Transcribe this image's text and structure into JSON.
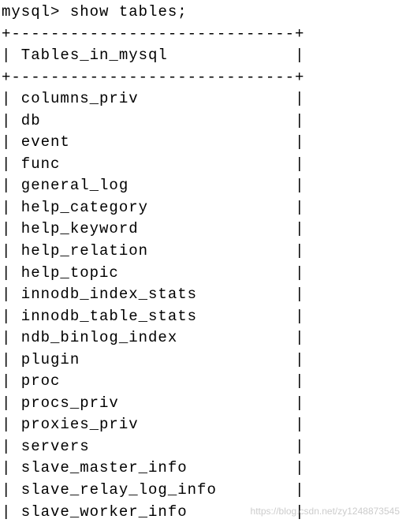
{
  "prompt": "mysql> ",
  "command": "show tables;",
  "border_top": "+-----------------------------+",
  "border_mid": "+-----------------------------+",
  "header": {
    "pipe_left": "|",
    "col_name": " Tables_in_mysql             ",
    "pipe_right": "|"
  },
  "rows": [
    " columns_priv                ",
    " db                          ",
    " event                       ",
    " func                        ",
    " general_log                 ",
    " help_category               ",
    " help_keyword                ",
    " help_relation               ",
    " help_topic                  ",
    " innodb_index_stats          ",
    " innodb_table_stats          ",
    " ndb_binlog_index            ",
    " plugin                      ",
    " proc                        ",
    " procs_priv                  ",
    " proxies_priv                ",
    " servers                     ",
    " slave_master_info           ",
    " slave_relay_log_info        ",
    " slave_worker_info           "
  ],
  "pipe": "|",
  "watermark": "https://blog.csdn.net/zy1248873545"
}
